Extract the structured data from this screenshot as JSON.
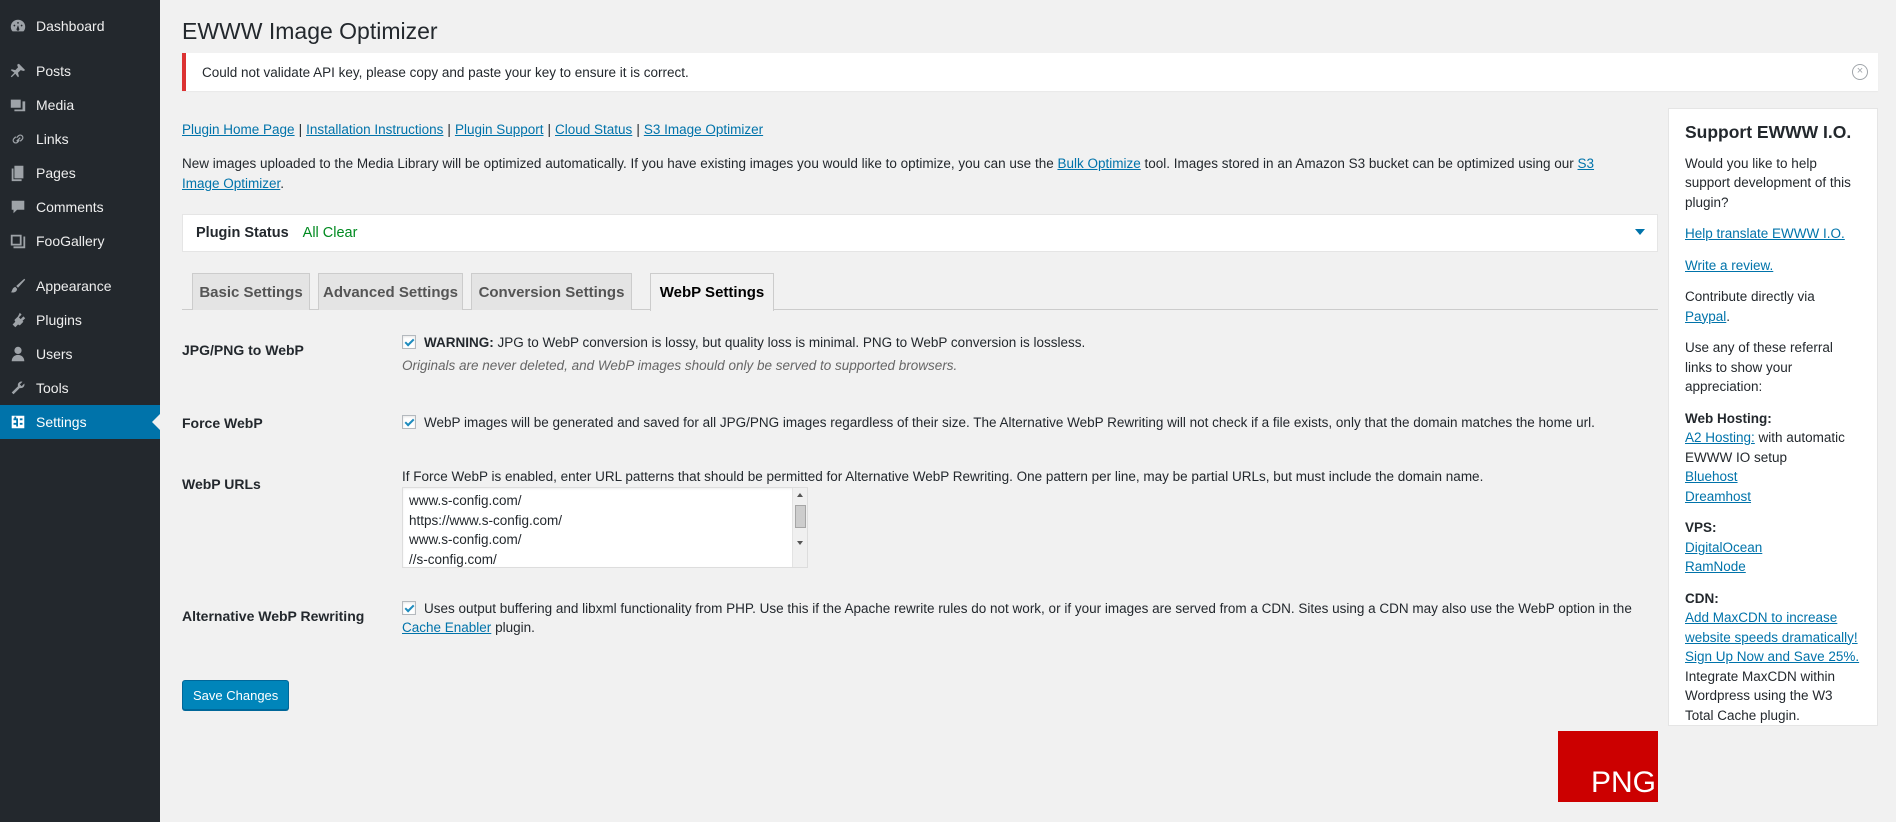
{
  "sidebar": {
    "items": [
      {
        "label": "Dashboard",
        "icon": "dashboard-icon"
      },
      {
        "label": "Posts",
        "icon": "pin-icon"
      },
      {
        "label": "Media",
        "icon": "media-icon"
      },
      {
        "label": "Links",
        "icon": "link-icon"
      },
      {
        "label": "Pages",
        "icon": "pages-icon"
      },
      {
        "label": "Comments",
        "icon": "comment-icon"
      },
      {
        "label": "FooGallery",
        "icon": "gallery-icon"
      },
      {
        "label": "Appearance",
        "icon": "brush-icon"
      },
      {
        "label": "Plugins",
        "icon": "plugin-icon"
      },
      {
        "label": "Users",
        "icon": "user-icon"
      },
      {
        "label": "Tools",
        "icon": "wrench-icon"
      },
      {
        "label": "Settings",
        "icon": "settings-icon"
      }
    ]
  },
  "page": {
    "title": "EWWW Image Optimizer",
    "notice": "Could not validate API key, please copy and paste your key to ensure it is correct.",
    "notice_dismiss": "×",
    "links": [
      "Plugin Home Page",
      "Installation Instructions",
      "Plugin Support",
      "Cloud Status",
      "S3 Image Optimizer"
    ],
    "link_separator": "|",
    "intro": {
      "part1": "New images uploaded to the Media Library will be optimized automatically. If you have existing images you would like to optimize, you can use the ",
      "link1": "Bulk Optimize",
      "part2": " tool. Images stored in an Amazon S3 bucket can be optimized using our ",
      "link2": "S3 Image Optimizer",
      "part3": "."
    },
    "status": {
      "label": "Plugin Status",
      "value": "All Clear"
    },
    "tabs": [
      "Basic Settings",
      "Advanced Settings",
      "Conversion Settings",
      "WebP Settings"
    ],
    "active_tab": "WebP Settings"
  },
  "settings": {
    "jpgpng": {
      "label": "JPG/PNG to WebP",
      "checked": true,
      "warning": "WARNING:",
      "text": " JPG to WebP conversion is lossy, but quality loss is minimal. PNG to WebP conversion is lossless.",
      "desc": "Originals are never deleted, and WebP images should only be served to supported browsers."
    },
    "force": {
      "label": "Force WebP",
      "checked": true,
      "text": "WebP images will be generated and saved for all JPG/PNG images regardless of their size. The Alternative WebP Rewriting will not check if a file exists, only that the domain matches the home url."
    },
    "urls": {
      "label": "WebP URLs",
      "text": "If Force WebP is enabled, enter URL patterns that should be permitted for Alternative WebP Rewriting. One pattern per line, may be partial URLs, but must include the domain name.",
      "lines": [
        "www.s-config.com/",
        "https://www.s-config.com/",
        "www.s-config.com/",
        "//s-config.com/"
      ]
    },
    "alt": {
      "label": "Alternative WebP Rewriting",
      "checked": true,
      "text1": "Uses output buffering and libxml functionality from PHP. Use this if the Apache rewrite rules do not work, or if your images are served from a CDN. Sites using a CDN may also use the WebP option in the ",
      "link": "Cache Enabler",
      "text2": " plugin."
    },
    "save_label": "Save Changes"
  },
  "badge": "PNG",
  "support": {
    "title": "Support EWWW I.O.",
    "ask": "Would you like to help support development of this plugin?",
    "translate": "Help translate EWWW I.O.",
    "review": "Write a review.",
    "contribute": "Contribute directly via ",
    "paypal": "Paypal",
    "contribute_end": ".",
    "referral": "Use any of these referral links to show your appreciation:",
    "hosting_title": "Web Hosting:",
    "a2": "A2 Hosting:",
    "a2_text": " with automatic EWWW IO setup",
    "bluehost": "Bluehost",
    "dreamhost": "Dreamhost",
    "vps_title": "VPS:",
    "digitalocean": "DigitalOcean",
    "ramnode": "RamNode",
    "cdn_title": "CDN:",
    "maxcdn": "Add MaxCDN to increase website speeds dramatically! Sign Up Now and Save 25%.",
    "maxcdn_text": " Integrate MaxCDN within Wordpress using the W3 Total Cache plugin."
  }
}
